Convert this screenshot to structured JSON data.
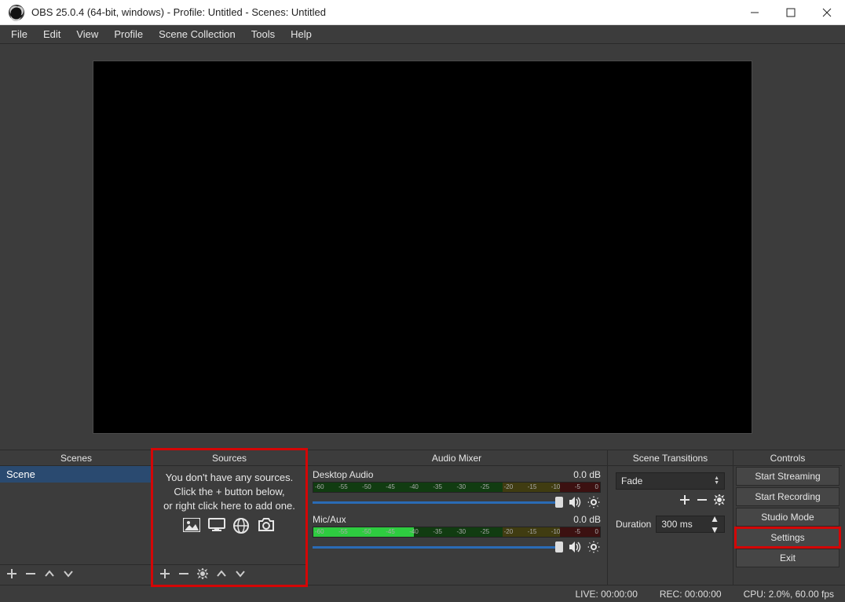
{
  "titlebar": {
    "title": "OBS 25.0.4 (64-bit, windows) - Profile: Untitled - Scenes: Untitled"
  },
  "menubar": [
    "File",
    "Edit",
    "View",
    "Profile",
    "Scene Collection",
    "Tools",
    "Help"
  ],
  "panels": {
    "scenes": {
      "title": "Scenes",
      "items": [
        "Scene"
      ]
    },
    "sources": {
      "title": "Sources",
      "empty1": "You don't have any sources.",
      "empty2": "Click the + button below,",
      "empty3": "or right click here to add one."
    },
    "mixer": {
      "title": "Audio Mixer",
      "channels": [
        {
          "name": "Desktop Audio",
          "level": "0.0 dB"
        },
        {
          "name": "Mic/Aux",
          "level": "0.0 dB"
        }
      ],
      "ticks": [
        "-60",
        "-55",
        "-50",
        "-45",
        "-40",
        "-35",
        "-30",
        "-25",
        "-20",
        "-15",
        "-10",
        "-5",
        "0"
      ]
    },
    "transitions": {
      "title": "Scene Transitions",
      "selected": "Fade",
      "duration_label": "Duration",
      "duration_value": "300 ms"
    },
    "controls": {
      "title": "Controls",
      "buttons": [
        "Start Streaming",
        "Start Recording",
        "Studio Mode",
        "Settings",
        "Exit"
      ]
    }
  },
  "status": {
    "live": "LIVE: 00:00:00",
    "rec": "REC: 00:00:00",
    "cpu": "CPU: 2.0%, 60.00 fps"
  }
}
